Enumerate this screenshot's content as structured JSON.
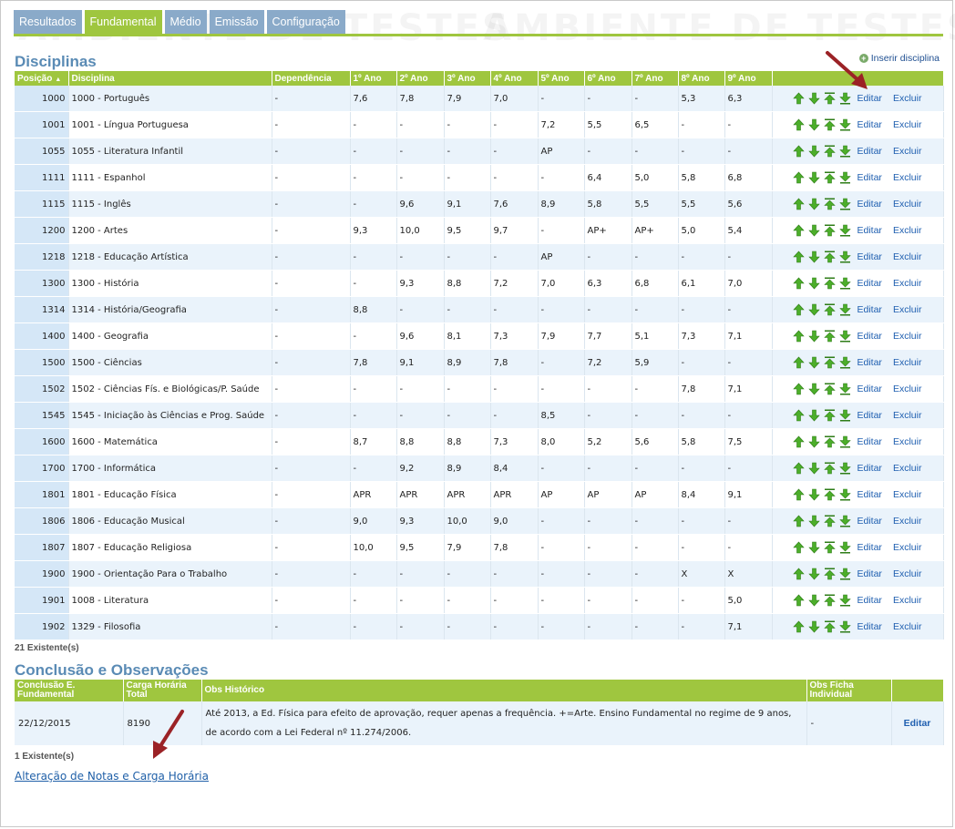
{
  "colors": {
    "tab_inactive": "#8aaac9",
    "tab_active": "#9fc63f",
    "header_green": "#9fc63f",
    "title_blue": "#5a8bb5",
    "link_blue": "#1f5fb0",
    "arrow_green": "#4cae2a",
    "callout_red": "#9b2226"
  },
  "watermark": "AMBIENTE DE TESTES",
  "tabs": [
    {
      "label": "Resultados",
      "active": false
    },
    {
      "label": "Fundamental",
      "active": true
    },
    {
      "label": "Médio",
      "active": false
    },
    {
      "label": "Emissão",
      "active": false
    },
    {
      "label": "Configuração",
      "active": false
    }
  ],
  "disciplinas": {
    "title": "Disciplinas",
    "insert_label": "Inserir disciplina",
    "insert_icon": "plus-circle-icon",
    "columns": [
      "Posição",
      "Disciplina",
      "Dependência",
      "1º Ano",
      "2º Ano",
      "3º Ano",
      "4º Ano",
      "5º Ano",
      "6º Ano",
      "7º Ano",
      "8º Ano",
      "9º Ano"
    ],
    "sort_indicator": "▲",
    "edit_label": "Editar",
    "delete_label": "Excluir",
    "row_action_icons": [
      "move-up-icon",
      "move-down-icon",
      "move-top-icon",
      "move-bottom-icon"
    ],
    "rows": [
      {
        "pos": "1000",
        "name": "1000 - Português",
        "dep": "-",
        "grades": [
          "7,6",
          "7,8",
          "7,9",
          "7,0",
          "-",
          "-",
          "-",
          "5,3",
          "6,3"
        ]
      },
      {
        "pos": "1001",
        "name": "1001 - Língua Portuguesa",
        "dep": "-",
        "grades": [
          "-",
          "-",
          "-",
          "-",
          "7,2",
          "5,5",
          "6,5",
          "-",
          "-"
        ]
      },
      {
        "pos": "1055",
        "name": "1055 - Literatura Infantil",
        "dep": "-",
        "grades": [
          "-",
          "-",
          "-",
          "-",
          "AP",
          "-",
          "-",
          "-",
          "-"
        ]
      },
      {
        "pos": "1111",
        "name": "1111 - Espanhol",
        "dep": "-",
        "grades": [
          "-",
          "-",
          "-",
          "-",
          "-",
          "6,4",
          "5,0",
          "5,8",
          "6,8"
        ]
      },
      {
        "pos": "1115",
        "name": "1115 - Inglês",
        "dep": "-",
        "grades": [
          "-",
          "9,6",
          "9,1",
          "7,6",
          "8,9",
          "5,8",
          "5,5",
          "5,5",
          "5,6"
        ]
      },
      {
        "pos": "1200",
        "name": "1200 - Artes",
        "dep": "-",
        "grades": [
          "9,3",
          "10,0",
          "9,5",
          "9,7",
          "-",
          "AP+",
          "AP+",
          "5,0",
          "5,4"
        ]
      },
      {
        "pos": "1218",
        "name": "1218 - Educação Artística",
        "dep": "-",
        "grades": [
          "-",
          "-",
          "-",
          "-",
          "AP",
          "-",
          "-",
          "-",
          "-"
        ]
      },
      {
        "pos": "1300",
        "name": "1300 - História",
        "dep": "-",
        "grades": [
          "-",
          "9,3",
          "8,8",
          "7,2",
          "7,0",
          "6,3",
          "6,8",
          "6,1",
          "7,0"
        ]
      },
      {
        "pos": "1314",
        "name": "1314 - História/Geografia",
        "dep": "-",
        "grades": [
          "8,8",
          "-",
          "-",
          "-",
          "-",
          "-",
          "-",
          "-",
          "-"
        ]
      },
      {
        "pos": "1400",
        "name": "1400 - Geografia",
        "dep": "-",
        "grades": [
          "-",
          "9,6",
          "8,1",
          "7,3",
          "7,9",
          "7,7",
          "5,1",
          "7,3",
          "7,1"
        ]
      },
      {
        "pos": "1500",
        "name": "1500 - Ciências",
        "dep": "-",
        "grades": [
          "7,8",
          "9,1",
          "8,9",
          "7,8",
          "-",
          "7,2",
          "5,9",
          "-",
          "-"
        ]
      },
      {
        "pos": "1502",
        "name": "1502 - Ciências Fís. e Biológicas/P. Saúde",
        "dep": "-",
        "grades": [
          "-",
          "-",
          "-",
          "-",
          "-",
          "-",
          "-",
          "7,8",
          "7,1"
        ]
      },
      {
        "pos": "1545",
        "name": "1545 - Iniciação às Ciências e Prog. Saúde",
        "dep": "-",
        "grades": [
          "-",
          "-",
          "-",
          "-",
          "8,5",
          "-",
          "-",
          "-",
          "-"
        ]
      },
      {
        "pos": "1600",
        "name": "1600 - Matemática",
        "dep": "-",
        "grades": [
          "8,7",
          "8,8",
          "8,8",
          "7,3",
          "8,0",
          "5,2",
          "5,6",
          "5,8",
          "7,5"
        ]
      },
      {
        "pos": "1700",
        "name": "1700 - Informática",
        "dep": "-",
        "grades": [
          "-",
          "9,2",
          "8,9",
          "8,4",
          "-",
          "-",
          "-",
          "-",
          "-"
        ]
      },
      {
        "pos": "1801",
        "name": "1801 - Educação Física",
        "dep": "-",
        "grades": [
          "APR",
          "APR",
          "APR",
          "APR",
          "AP",
          "AP",
          "AP",
          "8,4",
          "9,1"
        ]
      },
      {
        "pos": "1806",
        "name": "1806 - Educação Musical",
        "dep": "-",
        "grades": [
          "9,0",
          "9,3",
          "10,0",
          "9,0",
          "-",
          "-",
          "-",
          "-",
          "-"
        ]
      },
      {
        "pos": "1807",
        "name": "1807 - Educação Religiosa",
        "dep": "-",
        "grades": [
          "10,0",
          "9,5",
          "7,9",
          "7,8",
          "-",
          "-",
          "-",
          "-",
          "-"
        ]
      },
      {
        "pos": "1900",
        "name": "1900 - Orientação Para o Trabalho",
        "dep": "-",
        "grades": [
          "-",
          "-",
          "-",
          "-",
          "-",
          "-",
          "-",
          "X",
          "X"
        ]
      },
      {
        "pos": "1901",
        "name": "1008 - Literatura",
        "dep": "-",
        "grades": [
          "-",
          "-",
          "-",
          "-",
          "-",
          "-",
          "-",
          "-",
          "5,0"
        ]
      },
      {
        "pos": "1902",
        "name": "1329 - Filosofia",
        "dep": "-",
        "grades": [
          "-",
          "-",
          "-",
          "-",
          "-",
          "-",
          "-",
          "-",
          "7,1"
        ]
      }
    ],
    "count_label": "21 Existente(s)"
  },
  "conclusao": {
    "title": "Conclusão e Observações",
    "columns": [
      "Conclusão E. Fundamental",
      "Carga Horária Total",
      "Obs Histórico",
      "Obs Ficha Individual",
      ""
    ],
    "row": {
      "date": "22/12/2015",
      "hours": "8190",
      "obs": "Até 2013, a Ed. Física para efeito de aprovação, requer apenas a frequência. +=Arte. Ensino Fundamental no regime de 9 anos, de acordo com a Lei Federal nº 11.274/2006.",
      "obs_ficha": "-",
      "edit_label": "Editar"
    },
    "count_label": "1 Existente(s)"
  },
  "bottom_link": "Alteração de Notas e Carga Horária"
}
